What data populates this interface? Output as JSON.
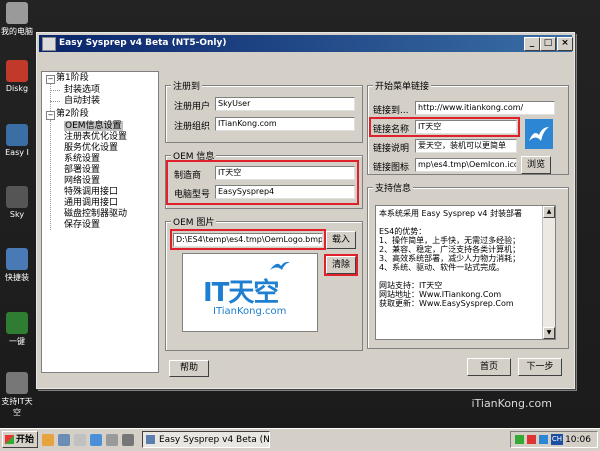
{
  "desktop": {
    "icons": [
      "我的电脑",
      "Diskg",
      "Easy I",
      "Sky",
      "快捷装",
      "一键",
      "支持IT天空"
    ],
    "watermark": "iTianKong.com"
  },
  "window": {
    "title": "Easy Sysprep v4 Beta (NT5-Only)",
    "buttons": {
      "min": "_",
      "max": "□",
      "close": "×"
    }
  },
  "tree": {
    "stage1": "第1阶段",
    "stage1_items": [
      "封装选项",
      "自动封装"
    ],
    "stage2": "第2阶段",
    "stage2_items": [
      "OEM信息设置",
      "注册表优化设置",
      "服务优化设置",
      "系统设置",
      "部署设置",
      "网络设置",
      "特殊调用接口",
      "通用调用接口",
      "磁盘控制器驱动",
      "保存设置"
    ],
    "selected_index": 0
  },
  "register": {
    "title": "注册到",
    "user_label": "注册用户",
    "user_value": "SkyUser",
    "org_label": "注册组织",
    "org_value": "ITianKong.com"
  },
  "oem_info": {
    "title": "OEM 信息",
    "maker_label": "制造商",
    "maker_value": "IT天空",
    "model_label": "电脑型号",
    "model_value": "EasySysprep4"
  },
  "oem_image": {
    "title": "OEM 图片",
    "path_value": "D:\\ES4\\temp\\es4.tmp\\OemLogo.bmp",
    "load_label": "载入",
    "clear_label": "清除",
    "logo_text": "IT天空",
    "logo_sub": "ITianKong.com"
  },
  "start_menu": {
    "title": "开始菜单链接",
    "link_to_label": "链接到...",
    "link_to_value": "http://www.itiankong.com/",
    "link_name_label": "链接名称",
    "link_name_value": "IT天空",
    "link_desc_label": "链接说明",
    "link_desc_value": "爱天空，装机可以更简单",
    "link_icon_label": "链接图标",
    "link_icon_value": "mp\\es4.tmp\\OemIcon.ico",
    "browse_label": "浏览"
  },
  "support": {
    "title": "支持信息",
    "lines": [
      "本系统采用 Easy Sysprep v4 封装部署",
      "",
      "ES4的优势：",
      "1、操作简单，上手快，无需过多经验；",
      "2、兼容、稳定，广泛支持各类计算机；",
      "3、高效系统部署，减少人力物力消耗；",
      "4、系统、驱动、软件一站式完成。",
      "",
      "网站支持：IT天空",
      "网站地址：Www.ITiankong.Com",
      "获取更新：Www.EasySysprep.Com"
    ]
  },
  "footer": {
    "help_label": "帮助",
    "home_label": "首页",
    "next_label": "下一步"
  },
  "taskbar": {
    "start_label": "开始",
    "task_label": "Easy Sysprep v4 Beta (N...",
    "tray_ch": "CH",
    "clock": "10:06"
  },
  "colors": {
    "title_start": "#0a246a",
    "title_end": "#3a6ea5",
    "highlight": "#e0202a",
    "brand_blue": "#1e7fd0"
  }
}
